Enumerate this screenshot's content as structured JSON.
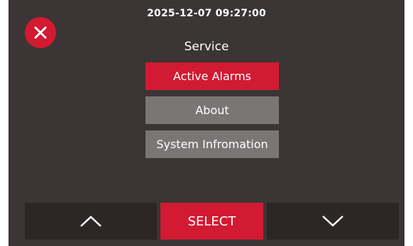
{
  "header": {
    "datetime": "2025-12-07 09:27:00",
    "title": "Service"
  },
  "menu": {
    "items": [
      {
        "label": "Active Alarms",
        "selected": true
      },
      {
        "label": "About",
        "selected": false
      },
      {
        "label": "System Infromation",
        "selected": false
      }
    ]
  },
  "footer": {
    "select_label": "SELECT"
  },
  "icons": {
    "close": "close-icon",
    "up": "chevron-up-icon",
    "down": "chevron-down-icon"
  },
  "colors": {
    "background": "#3b3535",
    "accent": "#d21a32",
    "menu_item": "#7a7676",
    "nav_button": "#2c2626",
    "text": "#ffffff"
  }
}
